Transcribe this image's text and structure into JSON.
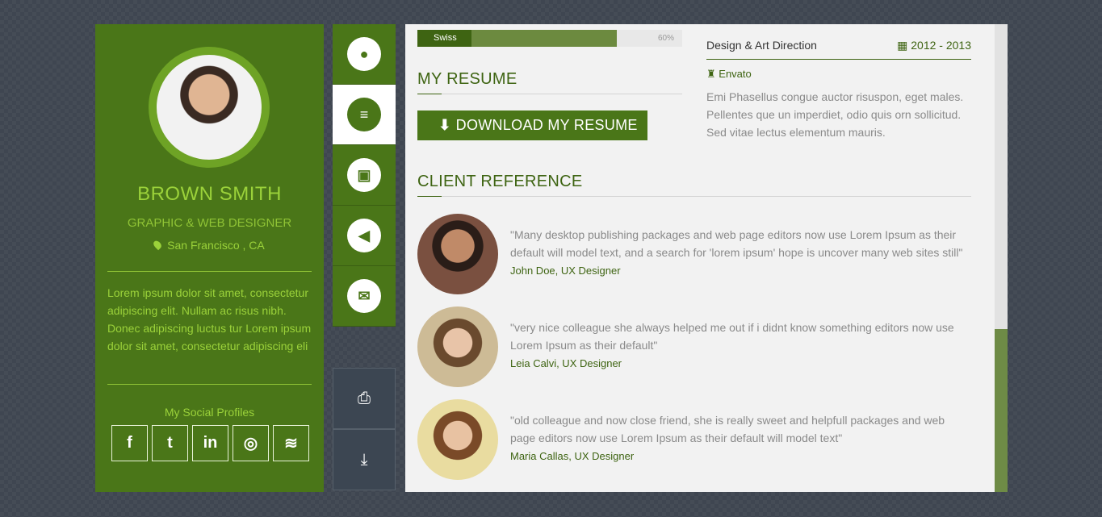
{
  "profile": {
    "name": "BROWN SMITH",
    "role": "GRAPHIC & WEB DESIGNER",
    "location": "San Francisco , CA",
    "about": "Lorem ipsum dolor sit amet, consectetur adipiscing elit. Nullam ac risus nibh. Donec adipiscing luctus tur Lorem ipsum dolor sit amet, consectetur adipiscing eli",
    "social_title": "My Social Profiles",
    "socials": [
      "facebook-icon",
      "twitter-icon",
      "linkedin-icon",
      "dribbble-icon",
      "stack-icon"
    ],
    "social_glyphs": [
      "f",
      "t",
      "in",
      "◎",
      "≋"
    ]
  },
  "nav": {
    "items": [
      {
        "icon": "user-icon",
        "glyph": "●"
      },
      {
        "icon": "resume-icon",
        "glyph": "≡"
      },
      {
        "icon": "briefcase-icon",
        "glyph": "▣"
      },
      {
        "icon": "megaphone-icon",
        "glyph": "◀"
      },
      {
        "icon": "envelope-icon",
        "glyph": "✉"
      }
    ],
    "active_index": 1
  },
  "tools": [
    {
      "icon": "print-icon",
      "glyph": "⎙"
    },
    {
      "icon": "download-icon",
      "glyph": "⤓"
    }
  ],
  "skill": {
    "label": "Swiss",
    "percent_text": "60%",
    "level": 0.6
  },
  "resume": {
    "heading": "MY RESUME",
    "button_label": "DOWNLOAD MY RESUME"
  },
  "experience": {
    "title": "Design & Art Direction",
    "dates": "2012 - 2013",
    "company": "Envato",
    "description": "Emi Phasellus congue auctor risuspon, eget males. Pellentes que un imperdiet, odio quis orn sollicitud. Sed vitae lectus elementum mauris."
  },
  "references": {
    "heading": "CLIENT REFERENCE",
    "items": [
      {
        "quote": "\"Many desktop publishing packages and web page editors now use Lorem Ipsum as their default will model text, and a search for 'lorem ipsum' hope is uncover many web sites still\"",
        "author": "John Doe, UX Designer"
      },
      {
        "quote": "\"very nice colleague she always helped me out if i didnt know something editors now use Lorem Ipsum as their default\"",
        "author": "Leia Calvi, UX Designer"
      },
      {
        "quote": "\"old colleague and now close friend, she is really sweet and helpfull packages and web page editors now use Lorem Ipsum as their default will model text\"",
        "author": "Maria Callas, UX Designer"
      }
    ]
  },
  "colors": {
    "brand": "#4a7618",
    "accent": "#9bd23a",
    "dark": "#3e6412"
  }
}
